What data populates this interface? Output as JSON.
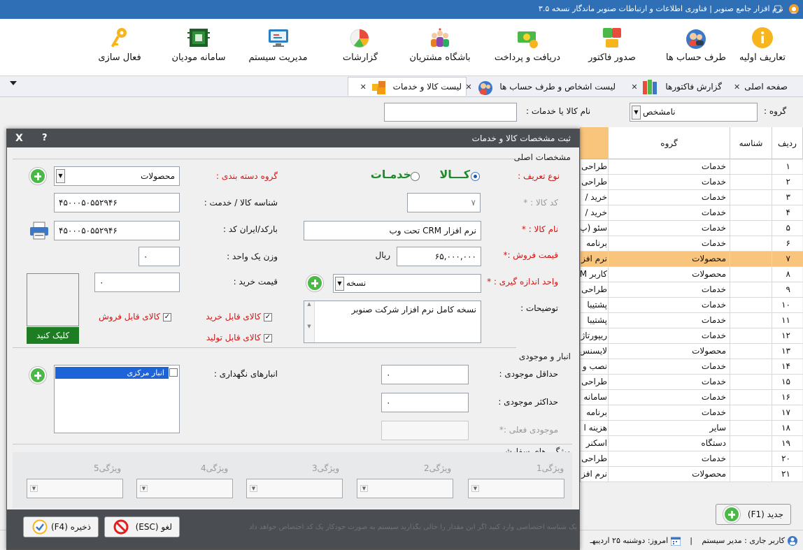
{
  "window": {
    "title": "نرم افزار جامع صنوبر | فناوری اطلاعات و ارتباطات صنوبر ماندگار نسخه ۳.۵",
    "controls": [
      "_",
      "▢",
      "✕"
    ]
  },
  "ribbon": {
    "items": [
      {
        "label": "تعاریف اولیه",
        "icon": "info-icon"
      },
      {
        "label": "طرف حساب ها",
        "icon": "people-icon"
      },
      {
        "label": "صدور فاکتور",
        "icon": "invoice-icon"
      },
      {
        "label": "دریافت و پرداخت",
        "icon": "money-icon"
      },
      {
        "label": "باشگاه مشتریان",
        "icon": "customers-club-icon"
      },
      {
        "label": "گزارشات",
        "icon": "pie-chart-icon"
      },
      {
        "label": "مدیریت سیستم",
        "icon": "monitor-icon"
      },
      {
        "label": "سامانه مودیان",
        "icon": "chip-icon"
      },
      {
        "label": "فعال سازی",
        "icon": "key-icon"
      }
    ]
  },
  "tabs": [
    {
      "label": "صفحه اصلی"
    },
    {
      "label": "گزارش فاکتورها"
    },
    {
      "label": "لیست اشخاص و طرف حساب ها"
    },
    {
      "label": "لیست کالا و خدمات"
    }
  ],
  "filter": {
    "group_label": "گروه :",
    "group_value": "نامشخص",
    "name_label": "نام کالا یا خدمات :",
    "name_value": ""
  },
  "grid": {
    "headers": {
      "row": "ردیف",
      "id": "شناسه",
      "group": "گروه"
    },
    "rows": [
      {
        "n": "۱",
        "g": "خدمات",
        "name": "طراحی"
      },
      {
        "n": "۲",
        "g": "خدمات",
        "name": "طراحی"
      },
      {
        "n": "۳",
        "g": "خدمات",
        "name": "خرید /"
      },
      {
        "n": "۴",
        "g": "خدمات",
        "name": "خرید /"
      },
      {
        "n": "۵",
        "g": "خدمات",
        "name": "سئو (پ"
      },
      {
        "n": "۶",
        "g": "خدمات",
        "name": "برنامه"
      },
      {
        "n": "۷",
        "g": "محصولات",
        "name": "نرم افز"
      },
      {
        "n": "۸",
        "g": "محصولات",
        "name": "کاربر M"
      },
      {
        "n": "۹",
        "g": "خدمات",
        "name": "طراحی"
      },
      {
        "n": "۱۰",
        "g": "خدمات",
        "name": "پشتیبا"
      },
      {
        "n": "۱۱",
        "g": "خدمات",
        "name": "پشتیبا"
      },
      {
        "n": "۱۲",
        "g": "خدمات",
        "name": "ریپورتاژ"
      },
      {
        "n": "۱۳",
        "g": "محصولات",
        "name": "لایسنس"
      },
      {
        "n": "۱۴",
        "g": "خدمات",
        "name": "نصب و"
      },
      {
        "n": "۱۵",
        "g": "خدمات",
        "name": "طراحی"
      },
      {
        "n": "۱۶",
        "g": "خدمات",
        "name": "سامانه"
      },
      {
        "n": "۱۷",
        "g": "خدمات",
        "name": "برنامه"
      },
      {
        "n": "۱۸",
        "g": "سایر",
        "name": "هزینه ا"
      },
      {
        "n": "۱۹",
        "g": "دستگاه",
        "name": "اسکنر"
      },
      {
        "n": "۲۰",
        "g": "خدمات",
        "name": "طراحی"
      },
      {
        "n": "۲۱",
        "g": "محصولات",
        "name": "نرم افز"
      }
    ],
    "selected_row": 6
  },
  "new_button": "جدید (F1)",
  "status": {
    "user": "کاربر جاری : مدیر سیستم",
    "date": "امروز: دوشنبه ۲۵ اردیبهـ"
  },
  "dialog": {
    "title": "ثبت مشخصات کالا و خدمات",
    "help": "?",
    "close": "X",
    "section_main": "مشخصات اصلی",
    "type_label": "نوع تعریف :",
    "type_goods": "کـــالا",
    "type_services": "خدمـات",
    "category_label": "گروه دسته بندی :",
    "category_value": "محصولات",
    "code_label": "کد کالا : *",
    "code_value": "۷",
    "sku_label": "شناسه کالا / خدمت :",
    "sku_value": "۴۵۰۰۰۵۰۵۵۲۹۴۶",
    "name_label": "نام کالا : *",
    "name_value": "نرم افزار CRM تحت وب",
    "barcode_label": "بارکد/ایران کد :",
    "barcode_value": "۴۵۰۰۰۵۰۵۵۲۹۴۶",
    "price_label": "قیمت فروش :*",
    "price_value": "۶۵,۰۰۰,۰۰۰",
    "currency": "ریال",
    "weight_label": "وزن یک واحد :",
    "weight_value": "۰",
    "unit_label": "واحد اندازه گیری : *",
    "unit_value": "نسخه",
    "buy_price_label": "قیمت خرید :",
    "buy_price_value": "۰",
    "desc_label": "توضیحات :",
    "desc_value": "نسخه کامل نرم افزار شرکت صنوبر",
    "chk_buyable": "کالای قابل خرید",
    "chk_sellable": "کالای قابل فروش",
    "chk_producible": "کالای قابل تولید",
    "image_button": "کلیک کنید",
    "section_stock": "انبار و موجودی",
    "warehouses_label": "انبارهای نگهداری :",
    "warehouse_item": "انبار مرکزی",
    "min_stock_label": "حداقل موجودی :",
    "min_stock_value": "۰",
    "max_stock_label": "حداکثر موجودی :",
    "max_stock_value": "۰",
    "current_stock_label": "موجودی فعلی :*",
    "current_stock_value": "",
    "section_custom": "ویژگی های سفارشی",
    "features": [
      "ویژگی1",
      "ویژگی2",
      "ویژگی3",
      "ویژگی4",
      "ویژگی5"
    ],
    "cancel_button": "لغو (ESC)",
    "save_button": "ذخیره (F4)",
    "hint": "یک شناسه اختصاصی وارد کنید اگر این مقدار را خالی بگذارید سیستم به صورت خودکار یک کد اختصاص خواهد داد"
  },
  "colors": {
    "titlebar": "#2f6fb6",
    "selected_row": "#f9c47c",
    "required": "#d01515",
    "services_green": "#1f8a2b",
    "image_button": "#1d7d22"
  }
}
